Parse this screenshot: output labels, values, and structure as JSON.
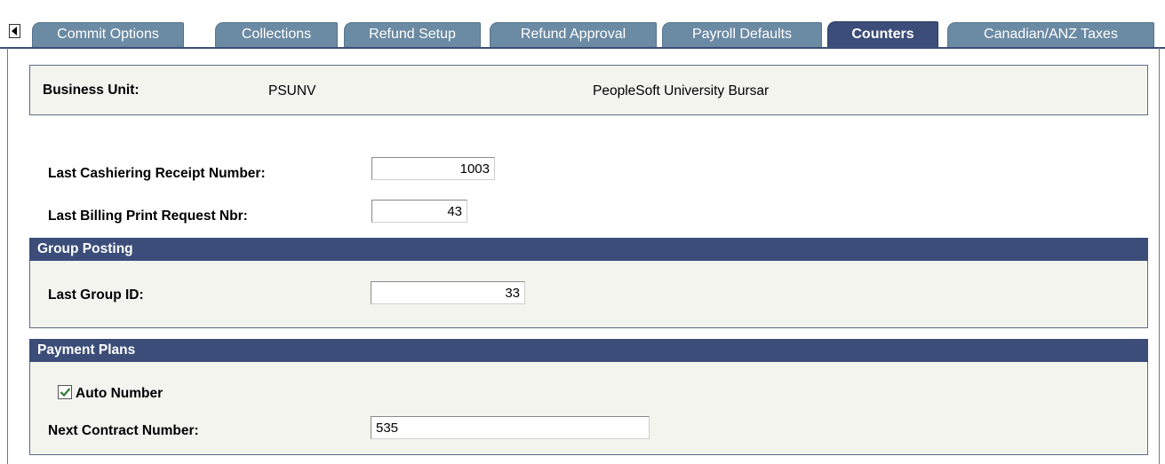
{
  "tabs": [
    {
      "label": "Commit Options",
      "active": false
    },
    {
      "label": "Collections",
      "active": false
    },
    {
      "label": "Refund Setup",
      "active": false
    },
    {
      "label": "Refund Approval",
      "active": false
    },
    {
      "label": "Payroll Defaults",
      "active": false
    },
    {
      "label": "Counters",
      "active": true
    },
    {
      "label": "Canadian/ANZ Taxes",
      "active": false
    }
  ],
  "business_unit": {
    "label": "Business Unit:",
    "code": "PSUNV",
    "description": "PeopleSoft University Bursar"
  },
  "counters": {
    "cashiering_label": "Last Cashiering Receipt Number:",
    "cashiering_value": "1003",
    "billing_label": "Last Billing Print Request Nbr:",
    "billing_value": "43"
  },
  "group_posting": {
    "title": "Group Posting",
    "last_group_label": "Last Group ID:",
    "last_group_value": "33"
  },
  "payment_plans": {
    "title": "Payment Plans",
    "auto_number_label": "Auto Number",
    "auto_number_checked": true,
    "next_contract_label": "Next Contract Number:",
    "next_contract_value": "535"
  },
  "colors": {
    "tab": "#6b8aa3",
    "tab_active": "#3b4d78",
    "section_header": "#3b4d78",
    "panel_bg": "#f4f4ef",
    "check_mark": "#2e7d32"
  }
}
